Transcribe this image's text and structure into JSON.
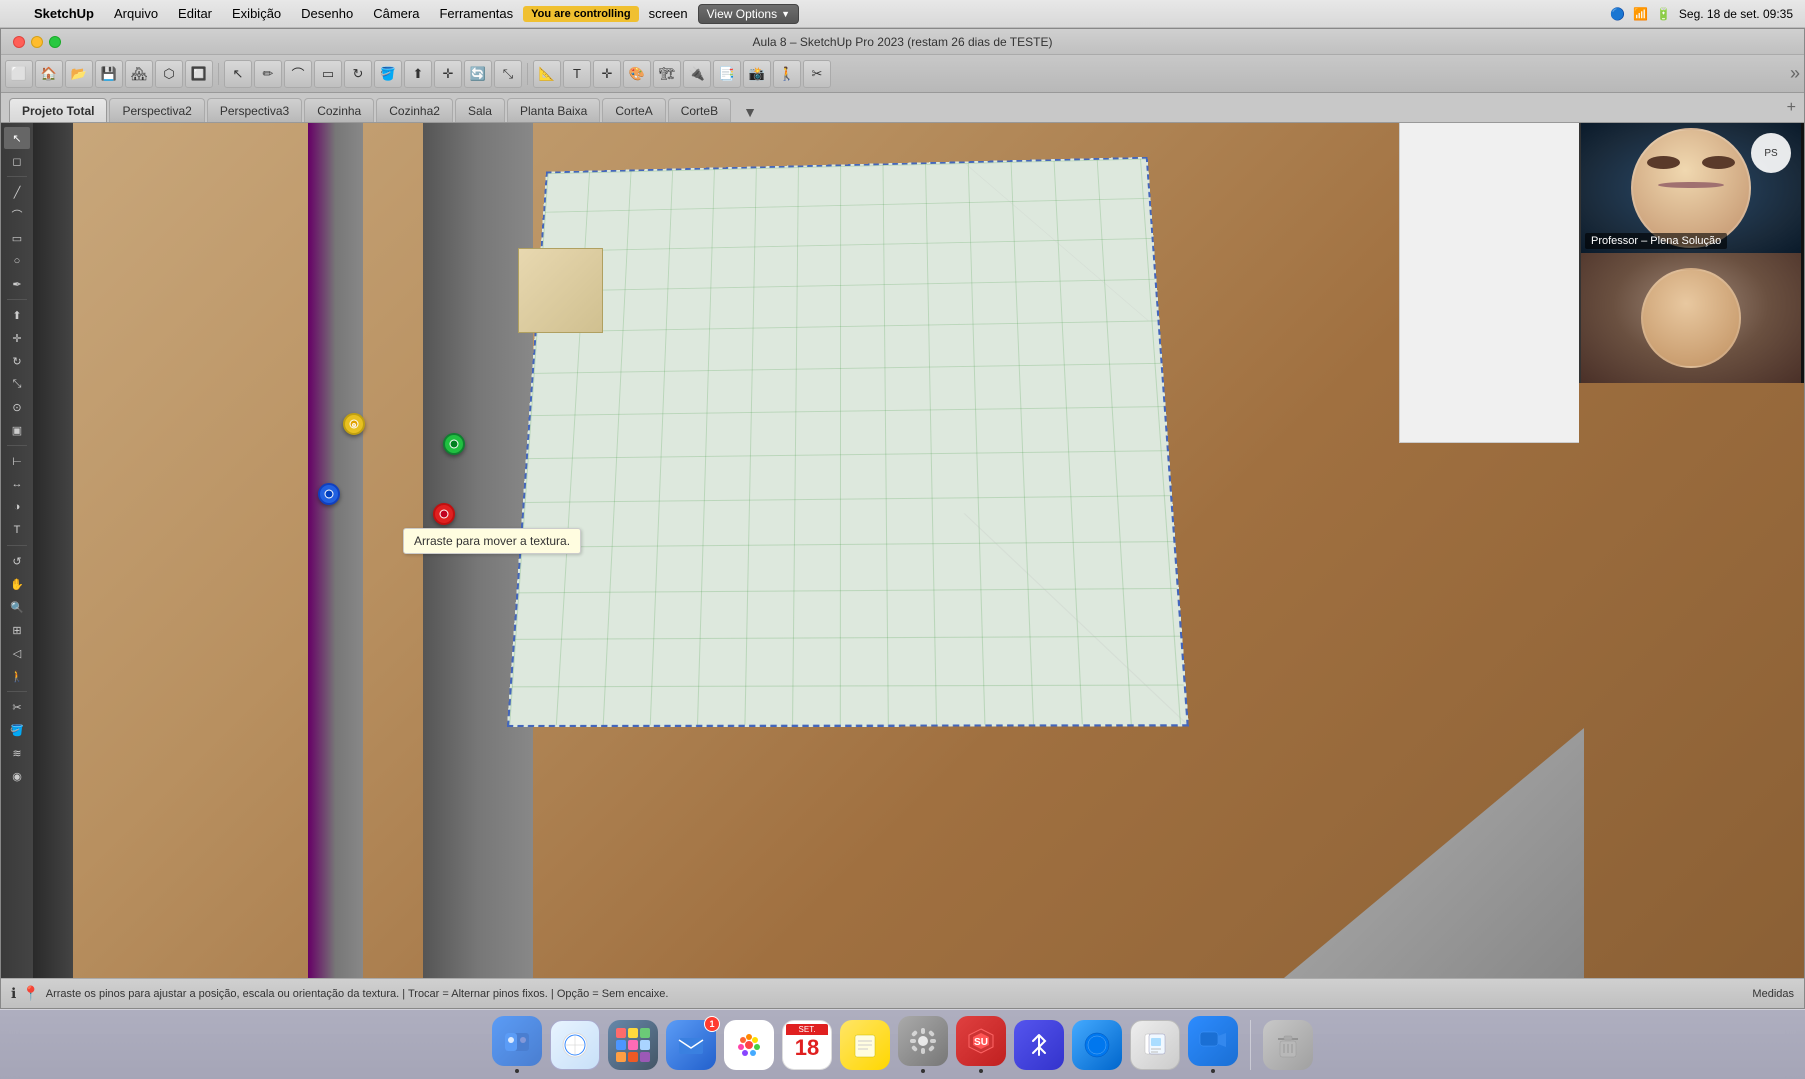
{
  "menubar": {
    "apple": "",
    "app_name": "SketchUp",
    "menus": [
      "Arquivo",
      "Editar",
      "Exibição",
      "Desenho",
      "Câmera",
      "Ferramentas"
    ],
    "you_are_controlling": "You are controlling",
    "screen": "screen",
    "view_options": "View Options",
    "time": "Seg. 18 de set.  09:35"
  },
  "titlebar": {
    "title": "Aula 8 – SketchUp Pro 2023 (restam 26 dias de TESTE)",
    "wifi_symbol": "📶"
  },
  "toolbar": {
    "tab_title": "Aula 8 – SketchUp Pro 2023 (restam 26 dias de TESTE)",
    "more": "»"
  },
  "scene_tabs": {
    "tabs": [
      {
        "label": "Projeto Total",
        "active": true
      },
      {
        "label": "Perspectiva2",
        "active": false
      },
      {
        "label": "Perspectiva3",
        "active": false
      },
      {
        "label": "Cozinha",
        "active": false
      },
      {
        "label": "Cozinha2",
        "active": false
      },
      {
        "label": "Sala",
        "active": false
      },
      {
        "label": "Planta Baixa",
        "active": false
      },
      {
        "label": "CorteA",
        "active": false
      },
      {
        "label": "CorteB",
        "active": false
      }
    ],
    "more_label": "▼",
    "add_label": "+"
  },
  "viewport": {
    "tooltip": "Arraste para mover a textura.",
    "pins": [
      {
        "color": "yellow",
        "label": "⚙"
      },
      {
        "color": "green",
        "label": "⚙"
      },
      {
        "color": "blue",
        "label": "⊕"
      },
      {
        "color": "red",
        "label": "⚙"
      }
    ]
  },
  "video_panel": {
    "professor_label": "Professor – Plena Solução",
    "professor_icon": "👨‍🏫",
    "student_icon": "👩"
  },
  "statusbar": {
    "info_icon": "ℹ",
    "pin_icon": "📍",
    "text": "Arraste os pinos para ajustar a posição, escala ou orientação da textura. | Trocar = Alternar pinos fixos. | Opção = Sem encaixe.",
    "right": "Medidas"
  },
  "dock": {
    "items": [
      {
        "name": "Finder",
        "icon": "🔍",
        "color_from": "#5b9cf6",
        "color_to": "#4a7ed0",
        "active": true
      },
      {
        "name": "Safari",
        "icon": "🧭",
        "color_from": "#55ccdd",
        "color_to": "#33aacc",
        "active": false
      },
      {
        "name": "Launchpad",
        "icon": "🚀",
        "color_from": "#888",
        "color_to": "#555",
        "active": false
      },
      {
        "name": "Mail",
        "icon": "✉️",
        "color_from": "#5b9cf6",
        "color_to": "#2260cc",
        "active": false,
        "badge": "1"
      },
      {
        "name": "Photos",
        "icon": "🌸",
        "color_from": "#ff6b6b",
        "color_to": "#ffd93d",
        "active": false
      },
      {
        "name": "Calendar",
        "icon": "18",
        "color_from": "#fff",
        "color_to": "#eee",
        "active": false
      },
      {
        "name": "Notes",
        "icon": "📝",
        "color_from": "#ffe44d",
        "color_to": "#ffd700",
        "active": false
      },
      {
        "name": "System Preferences",
        "icon": "⚙️",
        "color_from": "#999",
        "color_to": "#666",
        "active": false
      },
      {
        "name": "SketchUp",
        "icon": "🔷",
        "color_from": "#e04040",
        "color_to": "#c02020",
        "active": true
      },
      {
        "name": "Bluetooth",
        "icon": "🔵",
        "color_from": "#4444cc",
        "color_to": "#2222aa",
        "active": false
      },
      {
        "name": "Safari2",
        "icon": "🧭",
        "color_from": "#3399ff",
        "color_to": "#0066cc",
        "active": false
      },
      {
        "name": "Preview",
        "icon": "🖼",
        "color_from": "#f0f0f0",
        "color_to": "#d0d0d0",
        "active": false
      },
      {
        "name": "Zoom",
        "icon": "🎥",
        "color_from": "#2d8cff",
        "color_to": "#1a6fd4",
        "active": false
      },
      {
        "name": "Trash",
        "icon": "🗑",
        "color_from": "#c0c0c0",
        "color_to": "#a0a0a0",
        "active": false
      }
    ]
  }
}
